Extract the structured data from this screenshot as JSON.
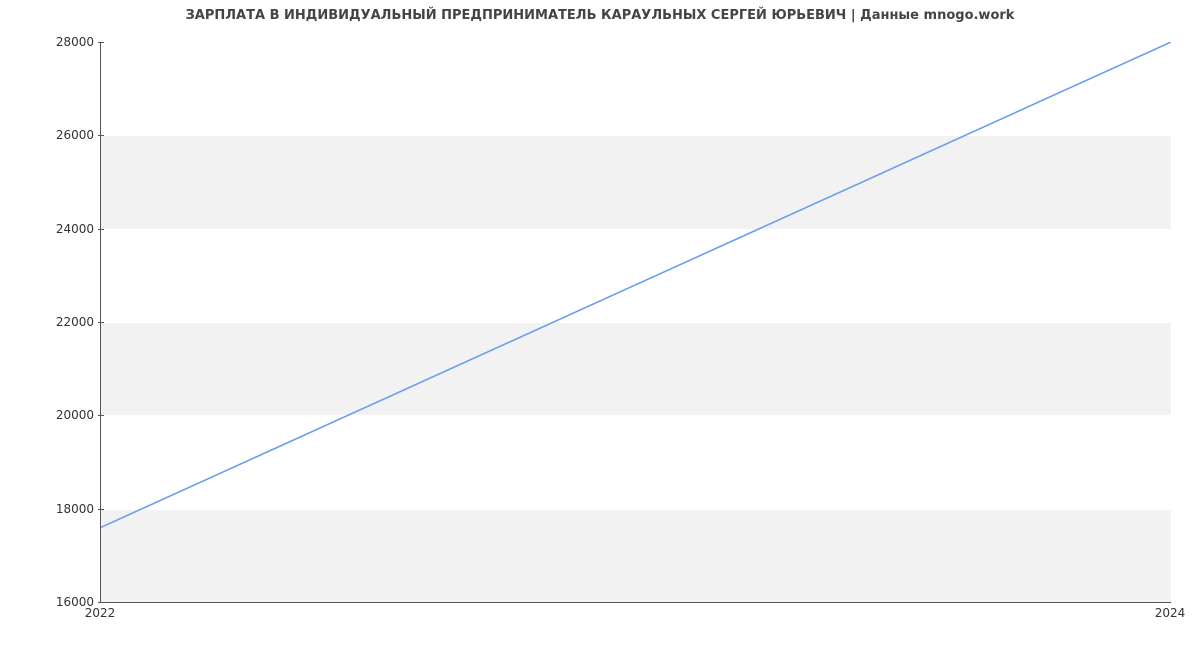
{
  "chart_data": {
    "type": "line",
    "title": "ЗАРПЛАТА В ИНДИВИДУАЛЬНЫЙ ПРЕДПРИНИМАТЕЛЬ КАРАУЛЬНЫХ СЕРГЕЙ ЮРЬЕВИЧ | Данные mnogo.work",
    "x": [
      2022,
      2024
    ],
    "values": [
      17600,
      28000
    ],
    "xlabel": "",
    "ylabel": "",
    "xlim": [
      2022,
      2024
    ],
    "ylim": [
      16000,
      28000
    ],
    "xticks": [
      2022,
      2024
    ],
    "yticks": [
      16000,
      18000,
      20000,
      22000,
      24000,
      26000,
      28000
    ],
    "line_color": "#6d9eeb",
    "grid_bands": true
  }
}
